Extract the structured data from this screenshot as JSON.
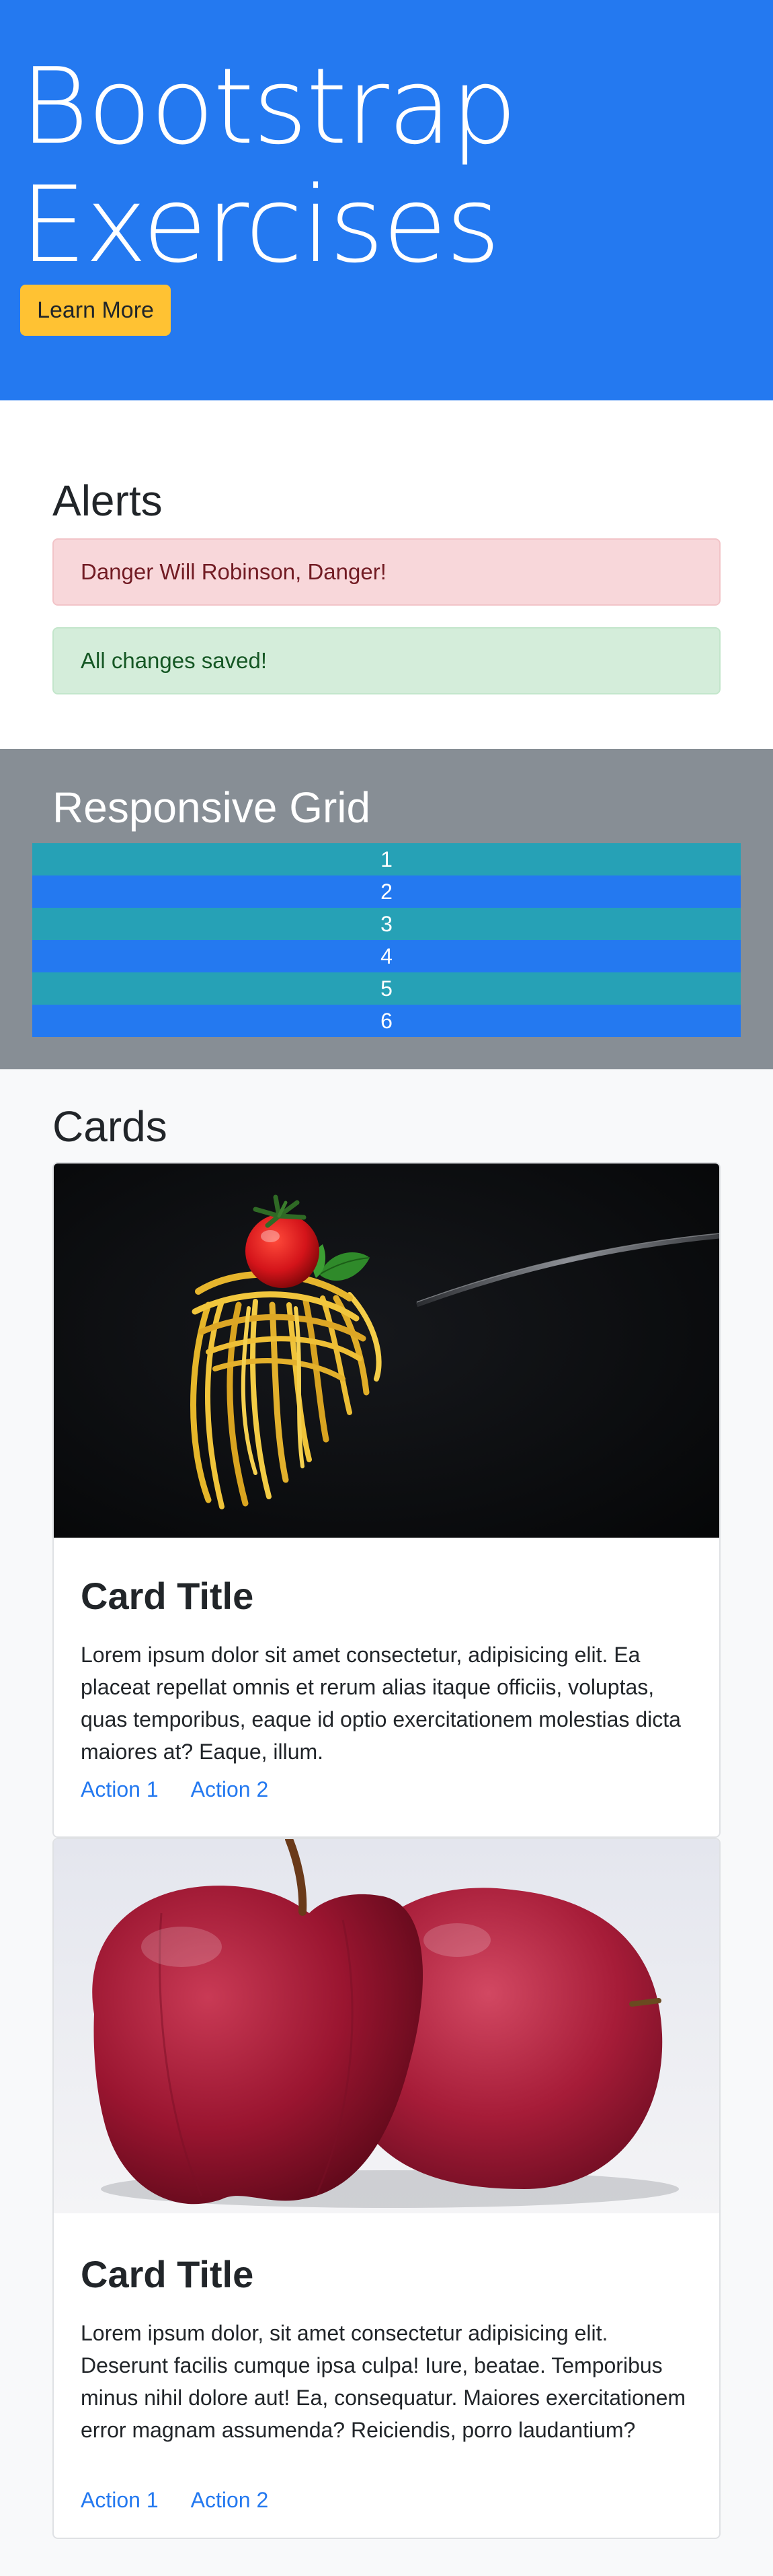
{
  "jumbotron": {
    "title_line1": "Bootstrap",
    "title_line2": "Exercises",
    "button_label": "Learn More",
    "bg_color": "#2479f0",
    "button_color": "#ffc233"
  },
  "alerts": {
    "title": "Alerts",
    "danger_text": "Danger Will Robinson, Danger!",
    "success_text": "All changes saved!"
  },
  "grid": {
    "title": "Responsive Grid",
    "rows": [
      "1",
      "2",
      "3",
      "4",
      "5",
      "6"
    ],
    "colors": [
      "#26a1b6",
      "#2479f0"
    ]
  },
  "cards": {
    "title": "Cards",
    "items": [
      {
        "image": "pasta-on-fork-with-tomato",
        "title": "Card Title",
        "text": "Lorem ipsum dolor sit amet consectetur, adipisicing elit. Ea placeat repellat omnis et rerum alias itaque officiis, voluptas, quas temporibus, eaque id optio exercitationem molestias dicta maiores at? Eaque, illum.",
        "action1": "Action 1",
        "action2": "Action 2"
      },
      {
        "image": "two-red-apples",
        "title": "Card Title",
        "text": "Lorem ipsum dolor, sit amet consectetur adipisicing elit. Deserunt facilis cumque ipsa culpa! Iure, beatae. Temporibus minus nihil dolore aut! Ea, consequatur. Maiores exercitationem error magnam assumenda? Reiciendis, porro laudantium?",
        "action1": "Action 1",
        "action2": "Action 2"
      }
    ]
  }
}
